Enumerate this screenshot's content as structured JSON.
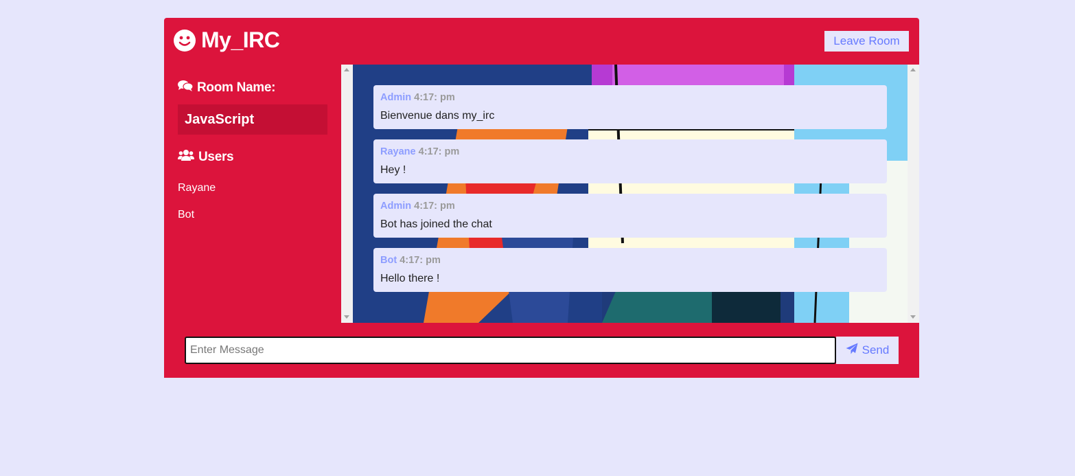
{
  "header": {
    "logo_icon": "smiley-face-icon",
    "title": "My_IRC",
    "leave_label": "Leave Room"
  },
  "sidebar": {
    "room_heading_icon": "comments-icon",
    "room_heading": "Room Name:",
    "room_name": "JavaScript",
    "users_heading_icon": "users-icon",
    "users_heading": "Users",
    "users": [
      "Rayane",
      "Bot"
    ]
  },
  "messages": [
    {
      "author": "Admin",
      "time": "4:17: pm",
      "text": "Bienvenue dans my_irc"
    },
    {
      "author": "Rayane",
      "time": "4:17: pm",
      "text": "Hey !"
    },
    {
      "author": "Admin",
      "time": "4:17: pm",
      "text": "Bot has joined the chat"
    },
    {
      "author": "Bot",
      "time": "4:17: pm",
      "text": "Hello there !"
    }
  ],
  "composer": {
    "placeholder": "Enter Message",
    "value": "",
    "send_icon": "paper-plane-icon",
    "send_label": "Send"
  },
  "colors": {
    "page_bg": "#e6e6fc",
    "app_bg": "#dc143c",
    "room_box_bg": "#c40f34",
    "accent": "#667aff"
  }
}
